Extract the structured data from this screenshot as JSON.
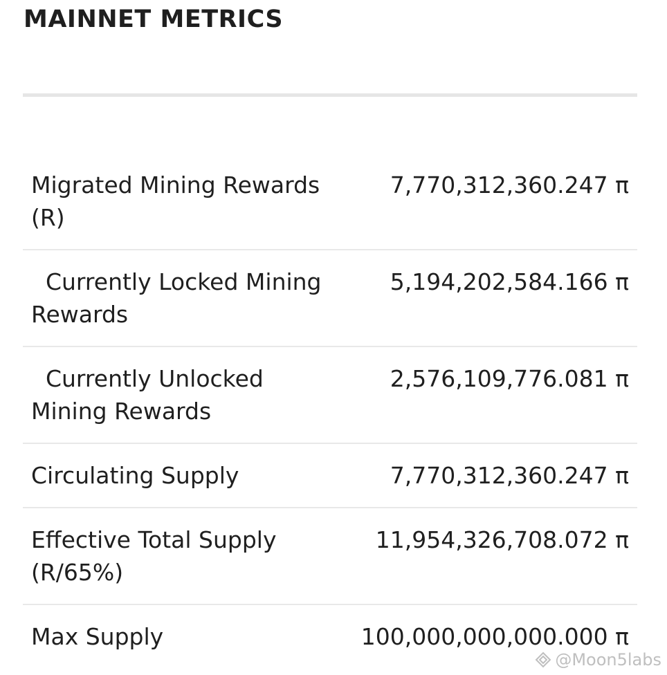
{
  "header": {
    "title": "MAINNET METRICS"
  },
  "metrics": [
    {
      "label": "Migrated Mining Rewards (R)",
      "value": "7,770,312,360.247 π"
    },
    {
      "label": "  Currently Locked Mining Rewards",
      "value": "5,194,202,584.166 π"
    },
    {
      "label": "  Currently Unlocked Mining Rewards",
      "value": "2,576,109,776.081 π"
    },
    {
      "label": "Circulating Supply",
      "value": "7,770,312,360.247 π"
    },
    {
      "label": "Effective Total Supply (R/65%)",
      "value": "11,954,326,708.072 π"
    },
    {
      "label": "Max Supply",
      "value": "100,000,000,000.000 π"
    }
  ],
  "watermark": {
    "text": "@Moon5labs"
  },
  "colors": {
    "text": "#1f1f1f",
    "divider": "#e6e6e6",
    "row_border": "#e8e8e8",
    "background": "#ffffff"
  }
}
